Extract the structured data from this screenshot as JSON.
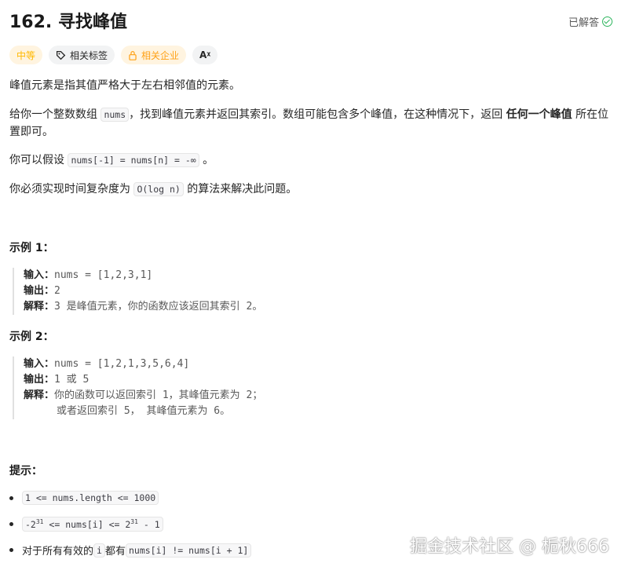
{
  "problem": {
    "title": "162. 寻找峰值",
    "status": "已解答"
  },
  "tags": [
    {
      "label": "中等",
      "icon": ""
    },
    {
      "label": "相关标签",
      "icon": "tag-icon"
    },
    {
      "label": "相关企业",
      "icon": "lock-icon"
    },
    {
      "label": "Aᵡ",
      "icon": "translate-icon"
    }
  ],
  "description": {
    "p1": "峰值元素是指其值严格大于左右相邻值的元素。",
    "p2a": "给你一个整数数组 ",
    "p2code": "nums",
    "p2b": "，找到峰值元素并返回其索引。数组可能包含多个峰值，在这种情况下，返回 ",
    "p2bold": "任何一个峰值",
    "p2c": " 所在位置即可。",
    "p3a": "你可以假设 ",
    "p3code": "nums[-1] = nums[n] = -∞",
    "p3b": " 。",
    "p4a": "你必须实现时间复杂度为 ",
    "p4code": "O(log n)",
    "p4b": " 的算法来解决此问题。"
  },
  "examples": [
    {
      "heading": "示例 1：",
      "input_label": "输入：",
      "input": "nums = [1,2,3,1]",
      "output_label": "输出：",
      "output": "2",
      "explain_label": "解释：",
      "explain": "3 是峰值元素，你的函数应该返回其索引 2。",
      "explain2": ""
    },
    {
      "heading": "示例 2：",
      "input_label": "输入：",
      "input": "nums = [1,2,1,3,5,6,4]",
      "output_label": "输出：",
      "output": "1 或 5",
      "explain_label": "解释：",
      "explain": "你的函数可以返回索引 1，其峰值元素为 2；",
      "explain2": "或者返回索引 5， 其峰值元素为 6。"
    }
  ],
  "hints": {
    "heading": "提示：",
    "h1": "1 <= nums.length <= 1000",
    "h2a": "-2",
    "h2sup1": "31",
    "h2b": " <= nums[i] <= 2",
    "h2sup2": "31",
    "h2c": " - 1",
    "h3a": "对于所有有效的 ",
    "h3code1": "i",
    "h3b": " 都有 ",
    "h3code2": "nums[i] != nums[i + 1]"
  },
  "watermark": "掘金技术社区 @ 栀秋666"
}
